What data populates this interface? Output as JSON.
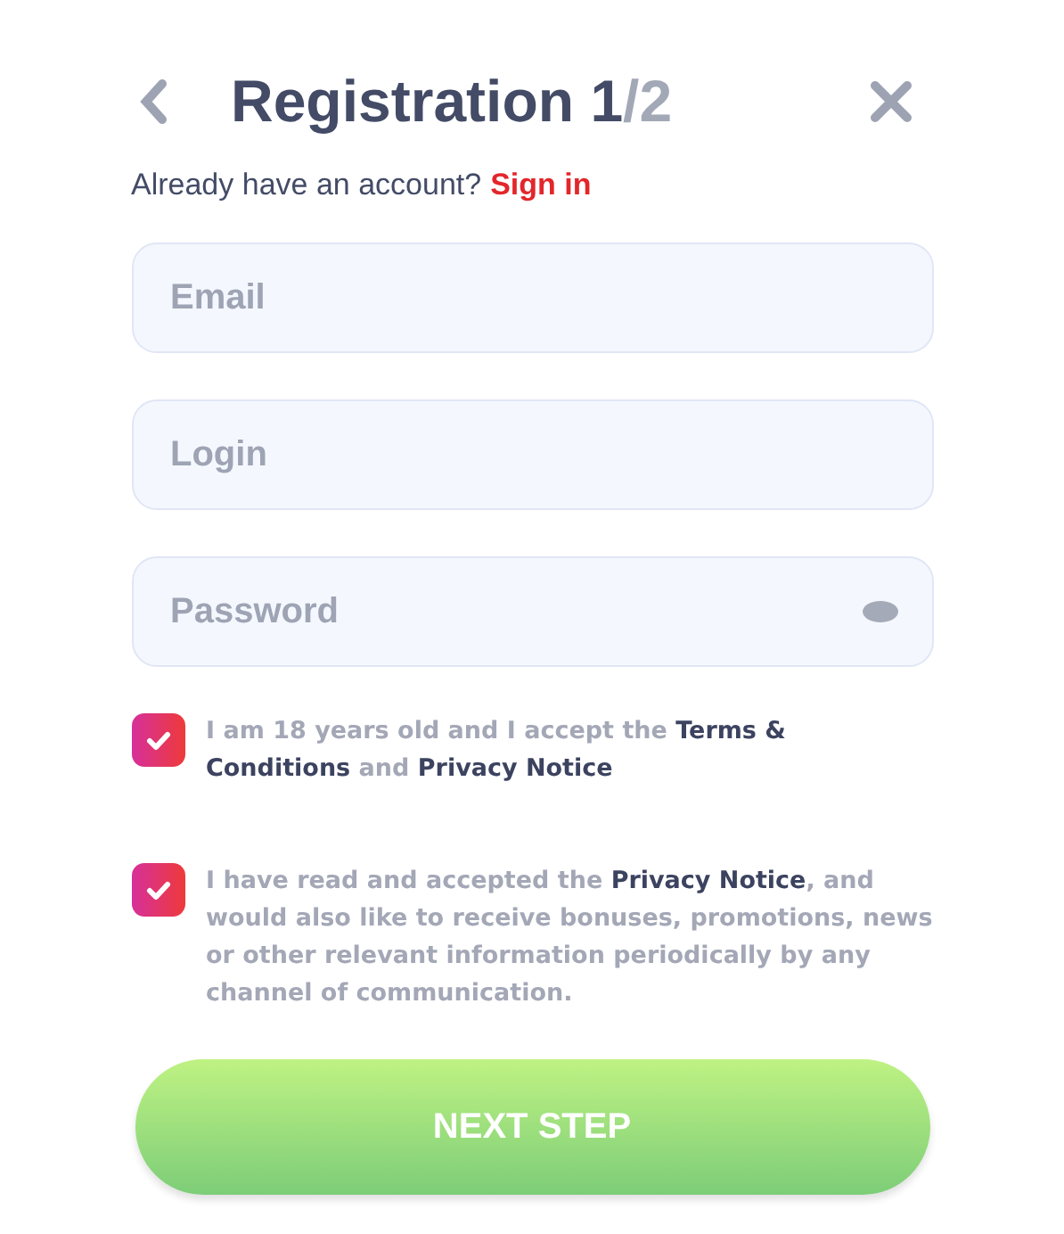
{
  "header": {
    "title": "Registration 1",
    "title_suffix": "/2"
  },
  "signin": {
    "prompt": "Already have an account?",
    "link": "Sign in"
  },
  "fields": [
    {
      "kind": "text",
      "placeholder": "Email"
    },
    {
      "kind": "text",
      "placeholder": "Login"
    },
    {
      "kind": "password",
      "placeholder": "Password"
    }
  ],
  "consents": [
    {
      "text": "I am 18 years old and I accept the **Terms & Conditions** and **Privacy Notice**",
      "checked": true
    },
    {
      "text": "I have read and accepted the **Privacy Notice**, and would also like to receive bonuses, promotions, news or other relevant information periodically by any channel of communication.",
      "checked": true
    }
  ],
  "submit": {
    "label": "NEXT STEP"
  }
}
